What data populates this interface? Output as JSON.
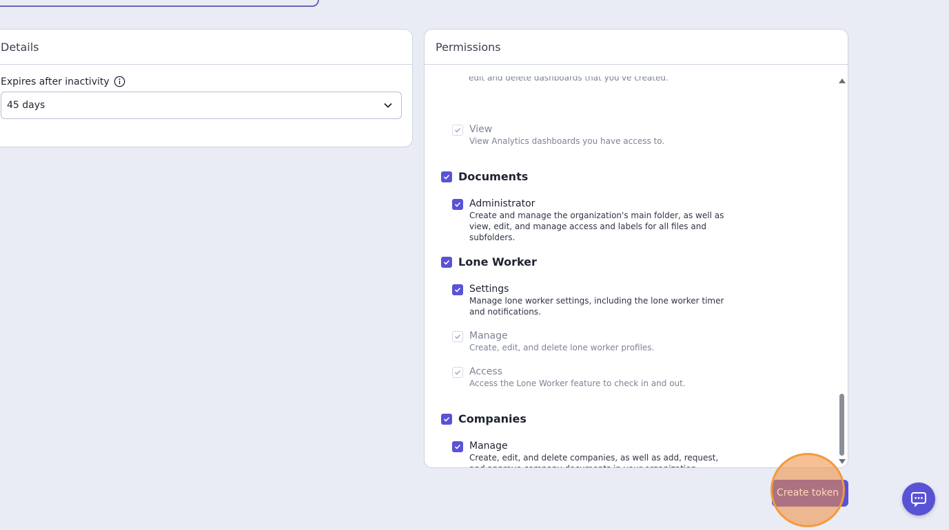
{
  "details": {
    "title": "Details",
    "expires_label": "Expires after inactivity",
    "expires_value": "45 days"
  },
  "permissions": {
    "title": "Permissions",
    "cut_desc": "edit and delete dashboards that you've created.",
    "analytics_view": {
      "name": "View",
      "desc": "View Analytics dashboards you have access to."
    },
    "documents": {
      "title": "Documents",
      "administrator": {
        "name": "Administrator",
        "desc": "Create and manage the organization's main folder, as well as view, edit, and manage access and labels for all files and subfolders."
      }
    },
    "lone_worker": {
      "title": "Lone Worker",
      "settings": {
        "name": "Settings",
        "desc": "Manage lone worker settings, including the lone worker timer and notifications."
      },
      "manage": {
        "name": "Manage",
        "desc": "Create, edit, and delete lone worker profiles."
      },
      "access": {
        "name": "Access",
        "desc": "Access the Lone Worker feature to check in and out."
      }
    },
    "companies": {
      "title": "Companies",
      "manage": {
        "name": "Manage",
        "desc": "Create, edit, and delete companies, as well as add, request, and approve company documents in your organization."
      }
    }
  },
  "actions": {
    "create_token": "Create token"
  },
  "colors": {
    "accent": "#5a52d6",
    "background": "#e9ecf5",
    "highlight": "#f39a3d"
  }
}
